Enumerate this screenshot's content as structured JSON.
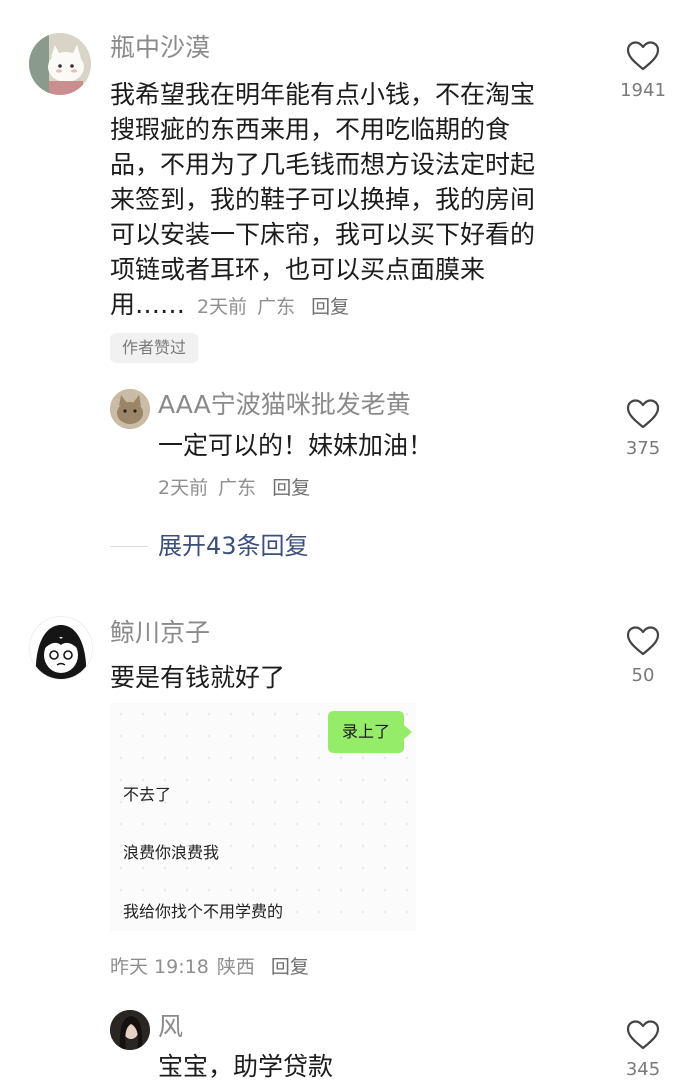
{
  "comments": [
    {
      "username": "瓶中沙漠",
      "lines": [
        "我希望我在明年能有点小钱，不在淘宝",
        "搜瑕疵的东西来用，不用吃临期的食",
        "品，不用为了几毛钱而想方设法定时起",
        "来签到，我的鞋子可以换掉，我的房间",
        "可以安装一下床帘，我可以买下好看的",
        "项链或者耳环，也可以买点面膜来"
      ],
      "last_line": "用……",
      "time": "2天前",
      "location": "广东",
      "reply_label": "回复",
      "badge": "作者赞过",
      "likes": "1941",
      "avatar_icon": "cat-cartoon-avatar-icon",
      "replies": [
        {
          "username": "AAA宁波猫咪批发老黄",
          "content": "一定可以的！妹妹加油！",
          "time": "2天前",
          "location": "广东",
          "reply_label": "回复",
          "likes": "375",
          "avatar_icon": "cat-photo-avatar-icon"
        }
      ],
      "expand_label": "展开43条回复"
    },
    {
      "username": "鲸川京子",
      "content": "要是有钱就好了",
      "likes": "50",
      "avatar_icon": "anime-girl-avatar-icon",
      "chat_image": {
        "green_bubble": "录上了",
        "lines": [
          "不去了",
          "浪费你浪费我",
          "我给你找个不用学费的"
        ]
      },
      "time": "昨天 19:18",
      "location": "陕西",
      "reply_label": "回复",
      "replies": [
        {
          "username": "风",
          "content": "宝宝，助学贷款",
          "likes": "345",
          "avatar_icon": "woman-photo-avatar-icon"
        }
      ]
    }
  ],
  "colors": {
    "username": "#8a8a8a",
    "content": "#1c1c1c",
    "meta": "#8f8f8f",
    "expand_link": "#3b4f7a",
    "chat_green": "#95ec69"
  }
}
